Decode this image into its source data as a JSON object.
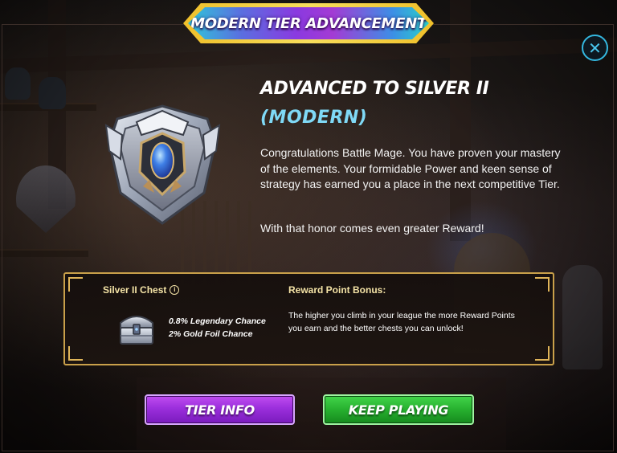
{
  "banner": {
    "title": "MODERN TIER ADVANCEMENT"
  },
  "close": {
    "label": "✕"
  },
  "tier": {
    "title": "ADVANCED TO SILVER II",
    "subtitle": "(MODERN)"
  },
  "message": {
    "paragraph1": "Congratulations Battle Mage. You have proven your mastery of the elements. Your formidable Power and keen sense of strategy has earned you a place in the next competitive Tier.",
    "paragraph2": "With that honor comes even greater Reward!"
  },
  "reward": {
    "chest_title": "Silver II Chest",
    "info_icon": "i",
    "chances": [
      "0.8% Legendary Chance",
      "2% Gold Foil Chance"
    ],
    "bonus_title": "Reward Point Bonus:",
    "bonus_text": "The higher you climb in your league the more Reward Points you earn and the better chests you can unlock!"
  },
  "buttons": {
    "tier_info": "TIER INFO",
    "keep_playing": "KEEP PLAYING"
  },
  "colors": {
    "accent_cyan": "#7fd9f6",
    "gold": "#c9a04a",
    "purple_button": "#9b2fdc",
    "green_button": "#27b02f"
  },
  "icons": {
    "tier_emblem": "silver-tier-shield-icon",
    "chest": "silver-chest-icon",
    "close": "close-icon",
    "info": "info-icon"
  }
}
